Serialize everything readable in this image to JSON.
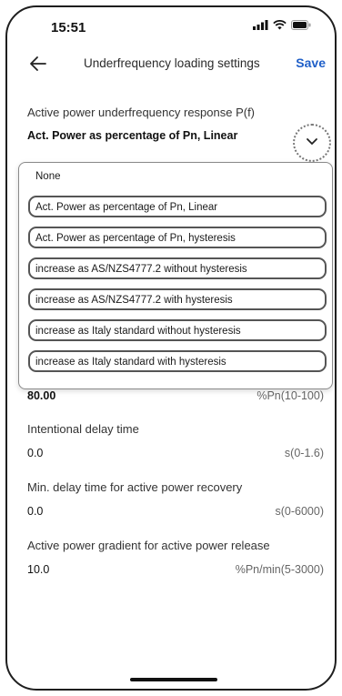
{
  "status_bar": {
    "time": "15:51"
  },
  "nav": {
    "title": "Underfrequency loading settings",
    "save_label": "Save"
  },
  "response": {
    "label": "Active power underfrequency response P(f)",
    "value": "Act. Power as percentage of Pn, Linear"
  },
  "dropdown": {
    "options": [
      "None",
      "Act. Power as percentage of Pn, Linear",
      "Act. Power as percentage of Pn, hysteresis",
      "increase as AS/NZS4777.2 without hysteresis",
      "increase as AS/NZS4777.2 with hysteresis",
      "increase as Italy standard without hysteresis",
      "increase as Italy standard with hysteresis"
    ]
  },
  "partial_row": {
    "value": "80.00",
    "range": "%Pn(10-100)"
  },
  "fields": [
    {
      "label": "Intentional delay time",
      "value": "0.0",
      "range": "s(0-1.6)"
    },
    {
      "label": "Min. delay time for active power recovery",
      "value": "0.0",
      "range": "s(0-6000)"
    },
    {
      "label": "Active power gradient for active power release",
      "value": "10.0",
      "range": "%Pn/min(5-3000)"
    }
  ],
  "colors": {
    "accent": "#1f5fc8",
    "text": "#222222",
    "muted": "#666666"
  },
  "icons": [
    "back-arrow-icon",
    "chevron-down-icon",
    "signal-icon",
    "wifi-icon",
    "battery-icon"
  ]
}
